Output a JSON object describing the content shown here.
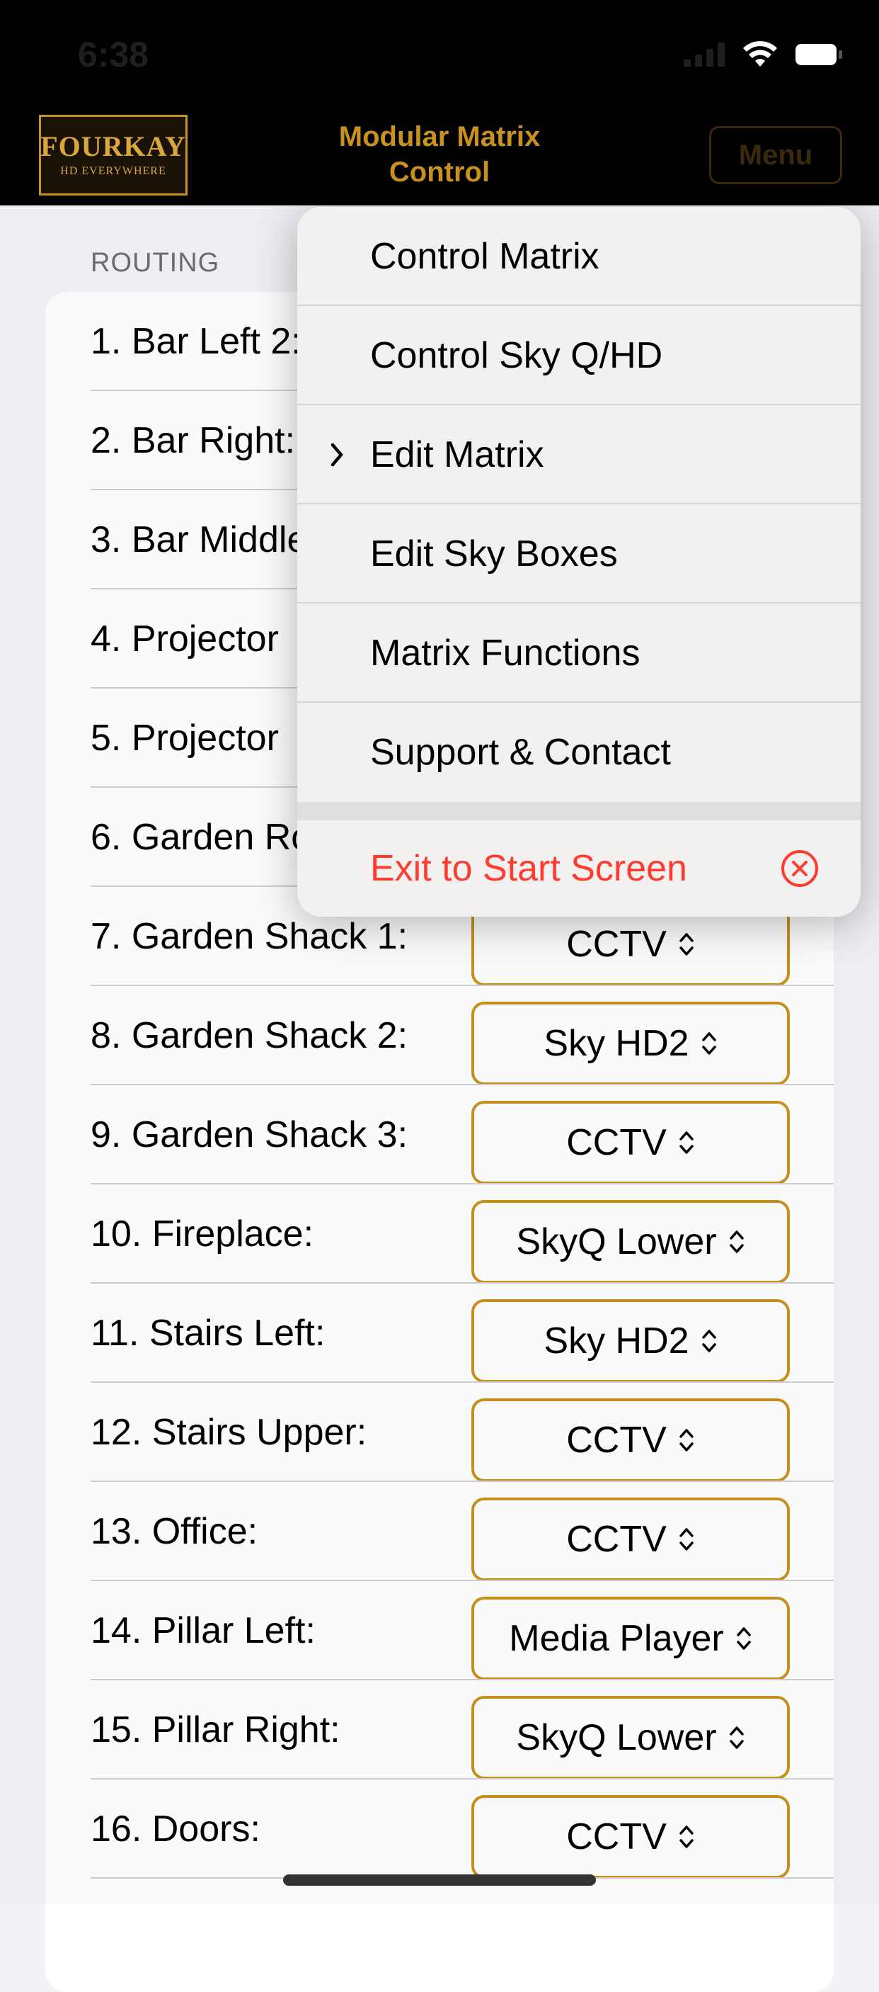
{
  "status_bar": {
    "time": "6:38"
  },
  "header": {
    "logo_main": "FOURKAY",
    "logo_sub": "HD EVERYWHERE",
    "title_line1": "Modular Matrix",
    "title_line2": "Control",
    "menu_label": "Menu"
  },
  "section": {
    "header": "ROUTING"
  },
  "rows": [
    {
      "label": "1. Bar Left 2:",
      "value": ""
    },
    {
      "label": "2. Bar Right:",
      "value": ""
    },
    {
      "label": "3. Bar Middle",
      "value": ""
    },
    {
      "label": "4. Projector",
      "value": ""
    },
    {
      "label": "5. Projector",
      "value": ""
    },
    {
      "label": "6. Garden Ro",
      "value": ""
    },
    {
      "label": "7. Garden Shack 1:",
      "value": "CCTV"
    },
    {
      "label": "8. Garden Shack 2:",
      "value": "Sky HD2"
    },
    {
      "label": "9. Garden Shack 3:",
      "value": "CCTV"
    },
    {
      "label": "10. Fireplace:",
      "value": "SkyQ Lower"
    },
    {
      "label": "11. Stairs Left:",
      "value": "Sky HD2"
    },
    {
      "label": "12. Stairs Upper:",
      "value": "CCTV"
    },
    {
      "label": "13. Office:",
      "value": "CCTV"
    },
    {
      "label": "14. Pillar Left:",
      "value": "Media Player"
    },
    {
      "label": "15. Pillar Right:",
      "value": "SkyQ Lower"
    },
    {
      "label": "16. Doors:",
      "value": "CCTV"
    }
  ],
  "menu": {
    "items": [
      {
        "label": "Control Matrix",
        "selected": false
      },
      {
        "label": "Control Sky Q/HD",
        "selected": false
      },
      {
        "label": "Edit Matrix",
        "selected": true
      },
      {
        "label": "Edit Sky Boxes",
        "selected": false
      },
      {
        "label": "Matrix Functions",
        "selected": false
      },
      {
        "label": "Support & Contact",
        "selected": false
      }
    ],
    "exit_label": "Exit to Start Screen"
  },
  "colors": {
    "accent": "#c9921f",
    "destructive": "#ff3b30",
    "background": "#f2f2f7"
  }
}
